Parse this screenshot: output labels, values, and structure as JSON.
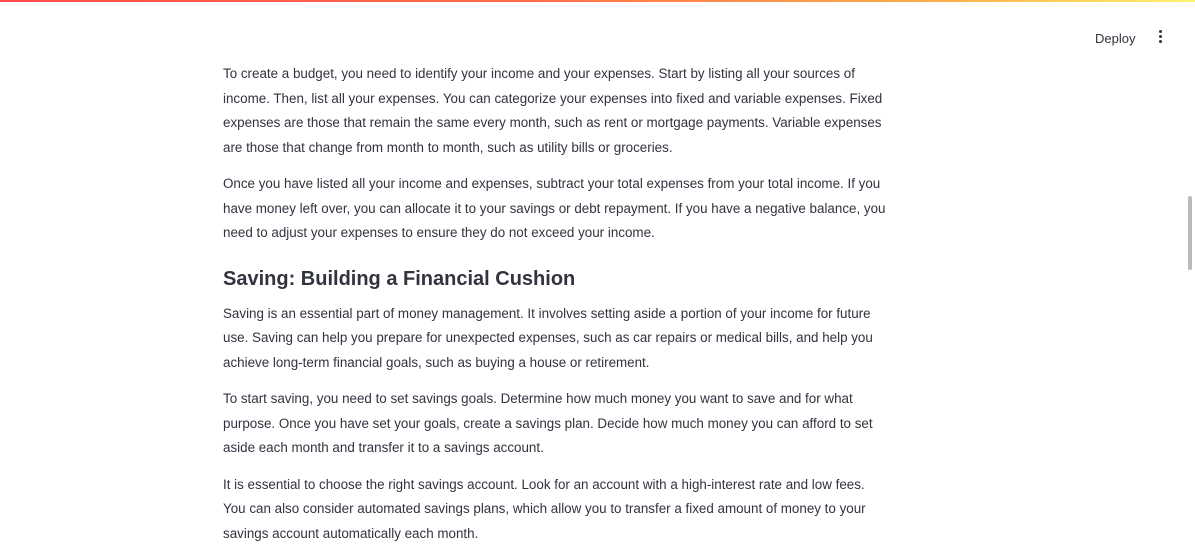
{
  "header": {
    "deploy_label": "Deploy"
  },
  "content": {
    "paragraphs_top": [
      "To create a budget, you need to identify your income and your expenses. Start by listing all your sources of income. Then, list all your expenses. You can categorize your expenses into fixed and variable expenses. Fixed expenses are those that remain the same every month, such as rent or mortgage payments. Variable expenses are those that change from month to month, such as utility bills or groceries.",
      "Once you have listed all your income and expenses, subtract your total expenses from your total income. If you have money left over, you can allocate it to your savings or debt repayment. If you have a negative balance, you need to adjust your expenses to ensure they do not exceed your income."
    ],
    "heading": "Saving: Building a Financial Cushion",
    "paragraphs_bottom": [
      "Saving is an essential part of money management. It involves setting aside a portion of your income for future use. Saving can help you prepare for unexpected expenses, such as car repairs or medical bills, and help you achieve long-term financial goals, such as buying a house or retirement.",
      "To start saving, you need to set savings goals. Determine how much money you want to save and for what purpose. Once you have set your goals, create a savings plan. Decide how much money you can afford to set aside each month and transfer it to a savings account.",
      "It is essential to choose the right savings account. Look for an account with a high-interest rate and low fees. You can also consider automated savings plans, which allow you to transfer a fixed amount of money to your savings account automatically each month."
    ]
  },
  "colors": {
    "text": "#31333f",
    "accent_gradient": [
      "#ff4b4b",
      "#ffb24b",
      "#fff36b"
    ]
  },
  "icons": {
    "menu": "kebab-menu-icon"
  }
}
